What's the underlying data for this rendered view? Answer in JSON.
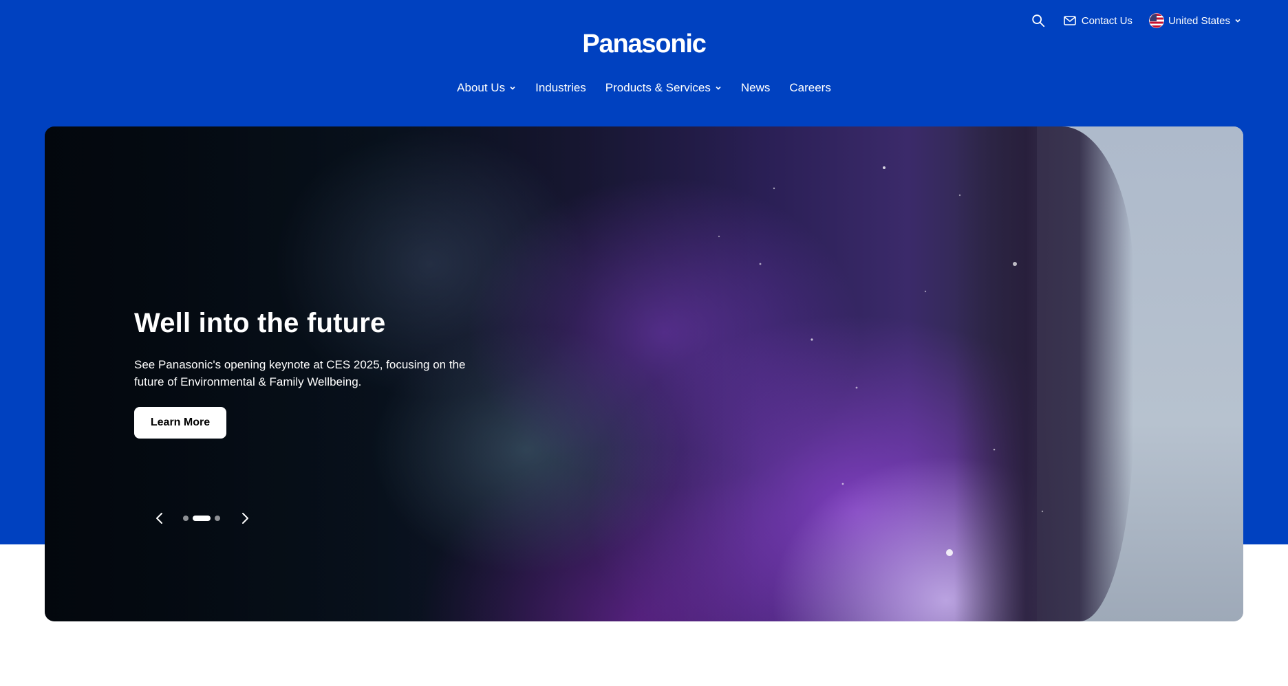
{
  "utility": {
    "search_icon": "search-icon",
    "contact_label": "Contact Us",
    "contact_icon": "mail-icon",
    "country_label": "United States",
    "country_icon": "us-flag-icon"
  },
  "header": {
    "logo_text": "Panasonic"
  },
  "nav": {
    "items": [
      {
        "label": "About Us",
        "has_dropdown": true
      },
      {
        "label": "Industries",
        "has_dropdown": false
      },
      {
        "label": "Products & Services",
        "has_dropdown": true
      },
      {
        "label": "News",
        "has_dropdown": false
      },
      {
        "label": "Careers",
        "has_dropdown": false
      }
    ]
  },
  "hero": {
    "title": "Well into the future",
    "description": "See Panasonic's opening keynote at CES 2025, focusing on the future of Environmental & Family Wellbeing.",
    "button_label": "Learn More",
    "carousel": {
      "slide_count": 3,
      "active_slide": 2
    }
  },
  "colors": {
    "brand_blue": "#0041c0",
    "text_on_blue": "#ffffff"
  }
}
